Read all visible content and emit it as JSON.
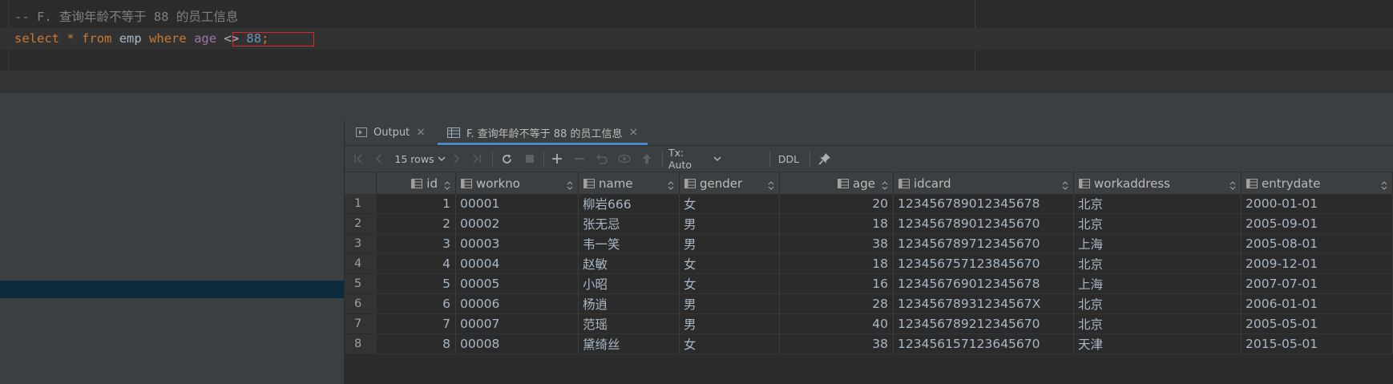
{
  "editor": {
    "comment": "-- F. 查询年龄不等于 88 的员工信息",
    "sql": {
      "select": "select",
      "star": "*",
      "from": "from",
      "table": "emp",
      "where": "where",
      "column": "age",
      "operator": "<>",
      "value": "88",
      "semicolon": ";"
    }
  },
  "tabs": {
    "output": "Output",
    "result": "F. 查询年龄不等于 88 的员工信息"
  },
  "toolbar": {
    "rows": "15 rows",
    "tx": "Tx: Auto",
    "ddl": "DDL"
  },
  "grid": {
    "columns": [
      "id",
      "workno",
      "name",
      "gender",
      "age",
      "idcard",
      "workaddress",
      "entrydate"
    ],
    "rows": [
      {
        "n": "1",
        "id": "1",
        "workno": "00001",
        "name": "柳岩666",
        "gender": "女",
        "age": "20",
        "idcard": "123456789012345678",
        "workaddress": "北京",
        "entrydate": "2000-01-01"
      },
      {
        "n": "2",
        "id": "2",
        "workno": "00002",
        "name": "张无忌",
        "gender": "男",
        "age": "18",
        "idcard": "123456789012345670",
        "workaddress": "北京",
        "entrydate": "2005-09-01"
      },
      {
        "n": "3",
        "id": "3",
        "workno": "00003",
        "name": "韦一笑",
        "gender": "男",
        "age": "38",
        "idcard": "123456789712345670",
        "workaddress": "上海",
        "entrydate": "2005-08-01"
      },
      {
        "n": "4",
        "id": "4",
        "workno": "00004",
        "name": "赵敏",
        "gender": "女",
        "age": "18",
        "idcard": "123456757123845670",
        "workaddress": "北京",
        "entrydate": "2009-12-01"
      },
      {
        "n": "5",
        "id": "5",
        "workno": "00005",
        "name": "小昭",
        "gender": "女",
        "age": "16",
        "idcard": "123456769012345678",
        "workaddress": "上海",
        "entrydate": "2007-07-01"
      },
      {
        "n": "6",
        "id": "6",
        "workno": "00006",
        "name": "杨逍",
        "gender": "男",
        "age": "28",
        "idcard": "12345678931234567X",
        "workaddress": "北京",
        "entrydate": "2006-01-01"
      },
      {
        "n": "7",
        "id": "7",
        "workno": "00007",
        "name": "范瑶",
        "gender": "男",
        "age": "40",
        "idcard": "123456789212345670",
        "workaddress": "北京",
        "entrydate": "2005-05-01"
      },
      {
        "n": "8",
        "id": "8",
        "workno": "00008",
        "name": "黛绮丝",
        "gender": "女",
        "age": "38",
        "idcard": "123456157123645670",
        "workaddress": "天津",
        "entrydate": "2015-05-01"
      }
    ]
  },
  "colors": {
    "highlight_box": "#e0242e",
    "tab_underline": "#4a88c7",
    "selected_row": "#0d293e"
  }
}
